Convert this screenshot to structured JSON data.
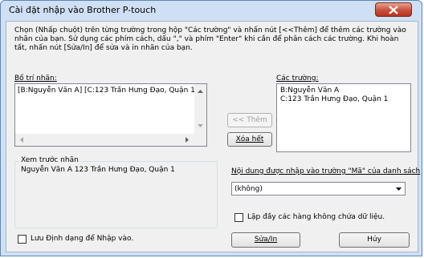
{
  "window": {
    "title": "Cài đặt nhập vào Brother P-touch"
  },
  "instructions": "Chọn (Nhấp chuột) trên từng trường trong hộp \"Các trường\" và nhấn nút [<<Thêm] để thêm các trường vào nhãn của bạn. Sử dụng các phím cách, dấu \",\" và phím \"Enter\" khi cần để phân cách các trường. Khi hoàn tất, nhấn nút [Sửa/In] để sửa và in nhãn của bạn.",
  "layout_panel": {
    "label": "Bố trí nhãn:",
    "text": "[B:Nguyễn Văn A] [C:123 Trần Hưng Đạo, Quận 1]"
  },
  "buttons": {
    "add": "<< Thêm",
    "clear": "Xóa hết",
    "edit_print": "Sửa/In",
    "cancel": "Hủy"
  },
  "fields_panel": {
    "label": "Các trường:",
    "items": [
      "B:Nguyễn Văn A",
      "C:123 Trần Hưng Đạo, Quận 1"
    ]
  },
  "preview": {
    "label": "Xem trước nhãn",
    "text": "Nguyễn Văn A 123 Trần Hưng Đạo, Quận 1"
  },
  "code_field": {
    "label": "Nội dung được nhập vào trường \"Mã\" của danh sách",
    "selected": "(không)"
  },
  "checkboxes": {
    "repeat_empty": "Lặp đầy các hàng không chứa dữ liệu.",
    "save_format": "Lưu Định dạng để Nhập vào."
  }
}
